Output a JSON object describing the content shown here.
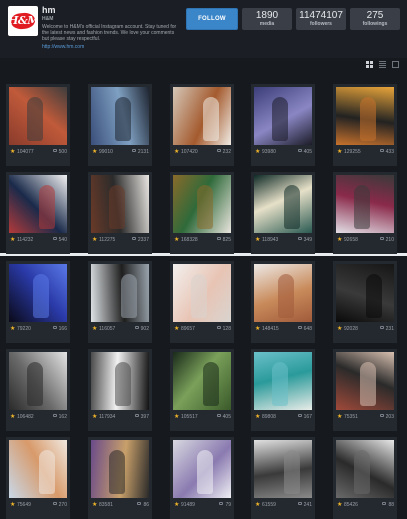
{
  "profile": {
    "logo_text": "H&M",
    "username": "hm",
    "fullname": "H&M",
    "bio": "Welcome to H&M's official Instagram account. Stay tuned for the latest news and fashion trends. We love your comments but please stay respectful.",
    "link": "http://www.hm.com"
  },
  "follow_label": "FOLLOW",
  "stats": [
    {
      "value": "1890",
      "label": "media"
    },
    {
      "value": "11474107",
      "label": "followers"
    },
    {
      "value": "275",
      "label": "followings"
    }
  ],
  "colors": {
    "accent": "#3b86c9",
    "background": "#16191e",
    "star": "#f0b52a"
  },
  "posts": [
    {
      "likes": "104077",
      "comments": "500",
      "colors": [
        "#8a3b2c",
        "#c05a3a",
        "#3d3d3d"
      ]
    },
    {
      "likes": "99010",
      "comments": "2131",
      "colors": [
        "#3a4f7a",
        "#7fa0c2",
        "#1e2430"
      ]
    },
    {
      "likes": "107420",
      "comments": "232",
      "colors": [
        "#d4c7b8",
        "#a45a2e",
        "#f1ece5"
      ]
    },
    {
      "likes": "93980",
      "comments": "405",
      "colors": [
        "#3b3e78",
        "#8a86c4",
        "#1c1c28"
      ]
    },
    {
      "likes": "129255",
      "comments": "433",
      "colors": [
        "#e8a43a",
        "#222222",
        "#c8722c"
      ]
    },
    {
      "likes": "114232",
      "comments": "540",
      "colors": [
        "#f2f2f2",
        "#1a2a4a",
        "#b33a3a"
      ]
    },
    {
      "likes": "112275",
      "comments": "2337",
      "colors": [
        "#e9e6e2",
        "#2b2b2b",
        "#6a3a28"
      ]
    },
    {
      "likes": "168328",
      "comments": "825",
      "colors": [
        "#e9e5de",
        "#2f6a3a",
        "#8a6a2a"
      ]
    },
    {
      "likes": "118943",
      "comments": "349",
      "colors": [
        "#2a5a52",
        "#e6e0c8",
        "#0e2a26"
      ]
    },
    {
      "likes": "92658",
      "comments": "210",
      "colors": [
        "#e2dfe6",
        "#8a2a4a",
        "#3a3a3a"
      ]
    },
    {
      "likes": "79220",
      "comments": "166",
      "colors": [
        "#0a0a18",
        "#2a3aa8",
        "#5a7ae8"
      ]
    },
    {
      "likes": "116057",
      "comments": "902",
      "colors": [
        "#dfe3e6",
        "#1e1e1e",
        "#9aa4ad"
      ]
    },
    {
      "likes": "89657",
      "comments": "128",
      "colors": [
        "#f2f0ee",
        "#e8c4b4",
        "#d9d4cf"
      ]
    },
    {
      "likes": "148415",
      "comments": "648",
      "colors": [
        "#ede9e6",
        "#c88a5a",
        "#a05a3a"
      ]
    },
    {
      "likes": "92028",
      "comments": "231",
      "colors": [
        "#161616",
        "#3a3a3a",
        "#0a0a0a"
      ]
    },
    {
      "likes": "106482",
      "comments": "162",
      "colors": [
        "#e4e4e4",
        "#6a6a6a",
        "#2a2a2a"
      ]
    },
    {
      "likes": "117934",
      "comments": "397",
      "colors": [
        "#121212",
        "#f2f2f2",
        "#4a4a4a"
      ]
    },
    {
      "likes": "105517",
      "comments": "405",
      "colors": [
        "#3a5a2a",
        "#7aa05a",
        "#1a2a1a"
      ]
    },
    {
      "likes": "89808",
      "comments": "167",
      "colors": [
        "#e8ece8",
        "#2a9a9a",
        "#6ac0c8"
      ]
    },
    {
      "likes": "75351",
      "comments": "203",
      "colors": [
        "#a04a3a",
        "#2a2a2a",
        "#d8c0b0"
      ]
    },
    {
      "likes": "75649",
      "comments": "270",
      "colors": [
        "#c8d8e8",
        "#d89a6a",
        "#f0e8e0"
      ]
    },
    {
      "likes": "83581",
      "comments": "86",
      "colors": [
        "#6a4a8a",
        "#c8a06a",
        "#2a2a2a"
      ]
    },
    {
      "likes": "91489",
      "comments": "79",
      "colors": [
        "#d8d8e0",
        "#8a7ab0",
        "#f0f0f4"
      ]
    },
    {
      "likes": "61559",
      "comments": "241",
      "colors": [
        "#e0e0e0",
        "#3a3a3a",
        "#8a8a8a"
      ]
    },
    {
      "likes": "85426",
      "comments": "88",
      "colors": [
        "#e8e8e8",
        "#2a2a2a",
        "#6a6a6a"
      ]
    }
  ]
}
